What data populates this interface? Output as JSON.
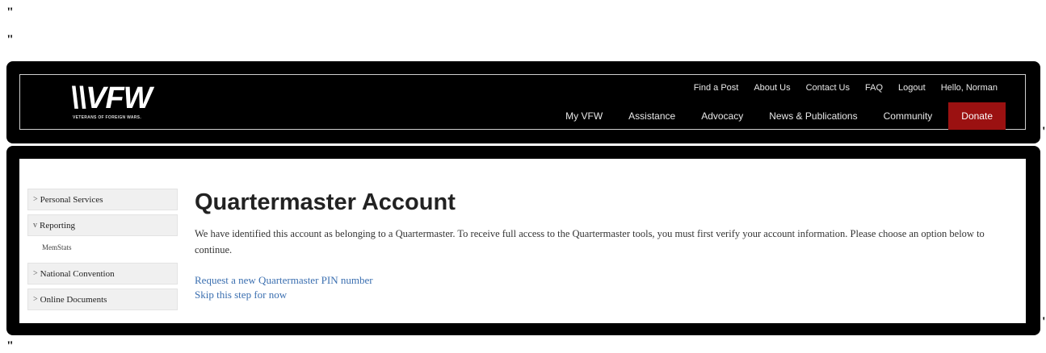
{
  "stray_marks": [
    "\"",
    "\"",
    "'",
    "'",
    "\""
  ],
  "header": {
    "logo_text": "\\\\VFW",
    "logo_subtitle": "VETERANS OF FOREIGN WARS.",
    "utility_links": [
      "Find a Post",
      "About Us",
      "Contact Us",
      "FAQ",
      "Logout",
      "Hello, Norman"
    ],
    "main_nav": [
      "My VFW",
      "Assistance",
      "Advocacy",
      "News & Publications",
      "Community"
    ],
    "donate_label": "Donate",
    "donate_color": "#9b1111"
  },
  "sidebar": {
    "items": [
      {
        "chevron": ">",
        "label": "Personal Services"
      },
      {
        "chevron": "v",
        "label": "Reporting"
      },
      {
        "chevron": ">",
        "label": "National Convention"
      },
      {
        "chevron": ">",
        "label": "Online Documents"
      }
    ],
    "sub_item": "MemStats"
  },
  "main": {
    "title": "Quartermaster Account",
    "paragraph": "We have identified this account as belonging to a Quartermaster. To receive full access to the Quartermaster tools, you must first verify your account information. Please choose an option below to continue.",
    "link_pin": "Request a new Quartermaster PIN number",
    "link_skip": "Skip this step for now",
    "link_color": "#3b6fb0"
  }
}
